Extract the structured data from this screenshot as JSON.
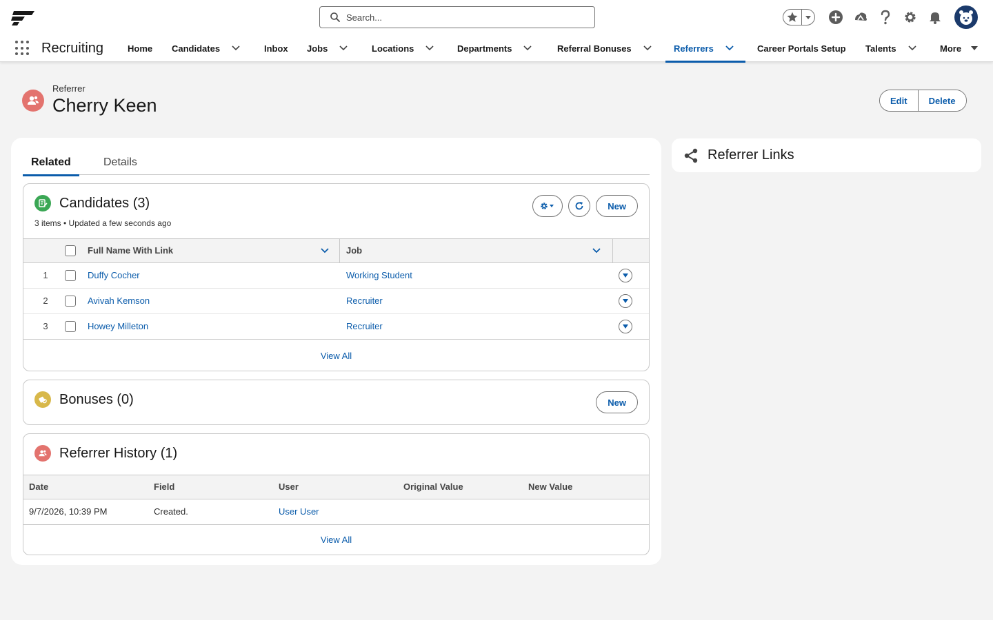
{
  "header": {
    "search_placeholder": "Search...",
    "icons": [
      "favorites-icon",
      "add-icon",
      "trailhead-icon",
      "help-icon",
      "setup-gear-icon",
      "notifications-bell-icon",
      "user-avatar"
    ]
  },
  "nav": {
    "app_name": "Recruiting",
    "items": [
      {
        "label": "Home",
        "dropdown": false
      },
      {
        "label": "Candidates",
        "dropdown": true
      },
      {
        "label": "Inbox",
        "dropdown": false
      },
      {
        "label": "Jobs",
        "dropdown": true
      },
      {
        "label": "Locations",
        "dropdown": true
      },
      {
        "label": "Departments",
        "dropdown": true
      },
      {
        "label": "Referral Bonuses",
        "dropdown": true
      },
      {
        "label": "Referrers",
        "dropdown": true,
        "active": true
      },
      {
        "label": "Career Portals Setup",
        "dropdown": false
      },
      {
        "label": "Talents",
        "dropdown": true
      },
      {
        "label": "More",
        "dropdown": true
      }
    ]
  },
  "record": {
    "type": "Referrer",
    "name": "Cherry Keen",
    "actions": {
      "edit": "Edit",
      "delete": "Delete"
    }
  },
  "tabs": {
    "related": "Related",
    "details": "Details",
    "active": "Related"
  },
  "candidates": {
    "title": "Candidates (3)",
    "subtitle": "3 items • Updated a few seconds ago",
    "new_label": "New",
    "columns": {
      "name": "Full Name With Link",
      "job": "Job"
    },
    "rows": [
      {
        "num": "1",
        "name": "Duffy Cocher",
        "job": "Working Student"
      },
      {
        "num": "2",
        "name": "Avivah Kemson",
        "job": "Recruiter"
      },
      {
        "num": "3",
        "name": "Howey Milleton",
        "job": "Recruiter"
      }
    ],
    "view_all": "View All"
  },
  "bonuses": {
    "title": "Bonuses (0)",
    "new_label": "New"
  },
  "history": {
    "title": "Referrer History (1)",
    "columns": {
      "date": "Date",
      "field": "Field",
      "user": "User",
      "original": "Original Value",
      "new": "New Value"
    },
    "rows": [
      {
        "date": "9/7/2026, 10:39 PM",
        "field": "Created.",
        "user": "User User",
        "original": "",
        "new": ""
      }
    ],
    "view_all": "View All"
  },
  "side": {
    "title": "Referrer Links"
  },
  "colors": {
    "brand": "#0b5cab",
    "referrer_icon": "#e3736e",
    "candidates_icon": "#3ba755",
    "bonuses_icon": "#d8b84a"
  }
}
